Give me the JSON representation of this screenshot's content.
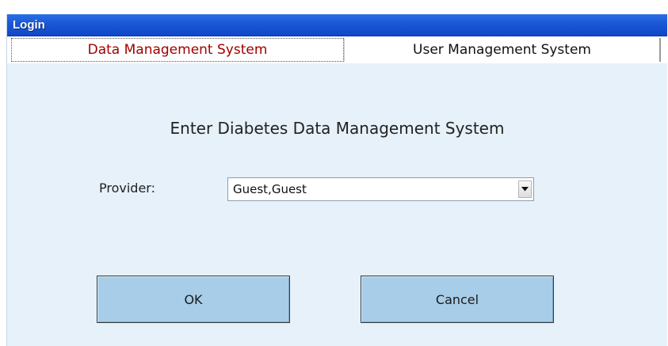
{
  "window": {
    "title": "Login"
  },
  "tabs": [
    {
      "label": "Data Management System",
      "active": true,
      "color": "#a10000"
    },
    {
      "label": "User Management System",
      "active": false,
      "color": "#111111"
    }
  ],
  "main": {
    "heading": "Enter Diabetes Data Management System",
    "provider_label": "Provider:",
    "provider_value": "Guest,Guest",
    "ok_label": "OK",
    "cancel_label": "Cancel"
  },
  "icons": {
    "dropdown": "chevron-down-icon"
  },
  "colors": {
    "titlebar": "#1a57d6",
    "background": "#e6f1f9",
    "button": "#a7cde8"
  }
}
